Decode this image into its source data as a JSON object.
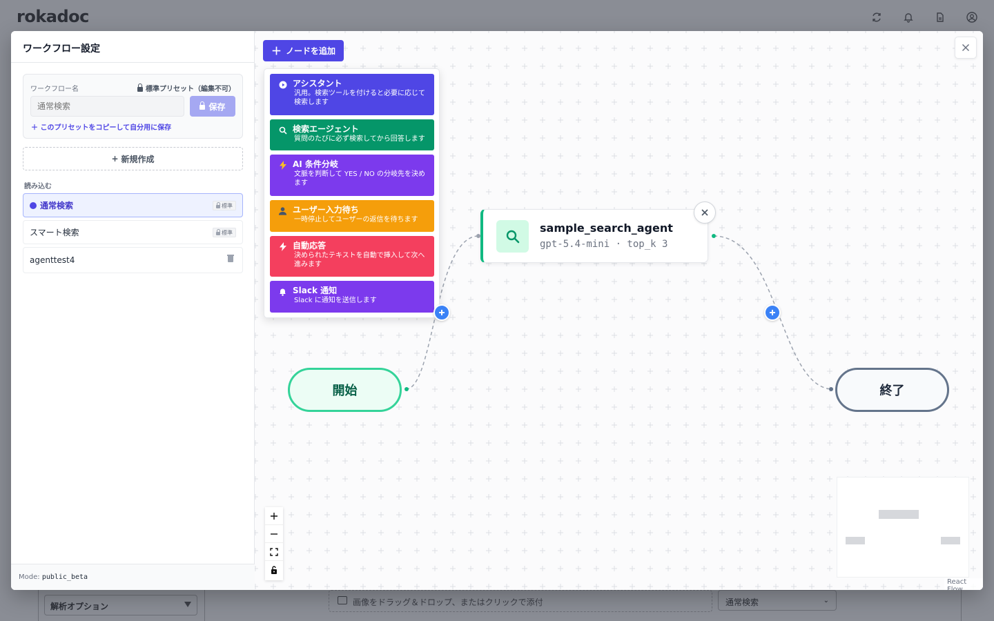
{
  "app": {
    "logo": "rokadoc"
  },
  "background": {
    "analysis_select": "解析オプション",
    "drop_text": "画像をドラッグ＆ドロップ、またはクリックで添付",
    "mode_select": "通常検索"
  },
  "sidebar": {
    "title": "ワークフロー設定",
    "workflow_name_label": "ワークフロー名",
    "preset_lock_label": "標準プリセット（編集不可）",
    "name_placeholder": "通常検索",
    "save_label": "保存",
    "copy_link": "このプリセットをコピーして自分用に保存",
    "new_button": "新規作成",
    "load_label": "読み込む",
    "presets": [
      {
        "name": "通常検索",
        "badge": "標準"
      },
      {
        "name": "スマート検索",
        "badge": "標準"
      },
      {
        "name": "agenttest4"
      }
    ],
    "footer_mode_label": "Mode:",
    "footer_mode_value": "public_beta"
  },
  "canvas": {
    "add_node_label": "ノードを追加",
    "menu": [
      {
        "title": "アシスタント",
        "desc": "汎用。検索ツールを付けると必要に応じて検索します",
        "color": "#4f46e5"
      },
      {
        "title": "検索エージェント",
        "desc": "質問のたびに必ず検索してから回答します",
        "color": "#059669"
      },
      {
        "title": "AI 条件分岐",
        "desc": "文脈を判断して YES / NO の分岐先を決めます",
        "color": "#7c3aed"
      },
      {
        "title": "ユーザー入力待ち",
        "desc": "一時停止してユーザーの返信を待ちます",
        "color": "#f59e0b"
      },
      {
        "title": "自動応答",
        "desc": "決められたテキストを自動で挿入して次へ進みます",
        "color": "#f43f5e"
      },
      {
        "title": "Slack 通知",
        "desc": "Slack に通知を送信します",
        "color": "#7c3aed"
      }
    ],
    "agent_node": {
      "name": "sample_search_agent",
      "meta": "gpt-5.4-mini · top_k 3"
    },
    "start_label": "開始",
    "end_label": "終了",
    "attribution": "React Flow"
  }
}
